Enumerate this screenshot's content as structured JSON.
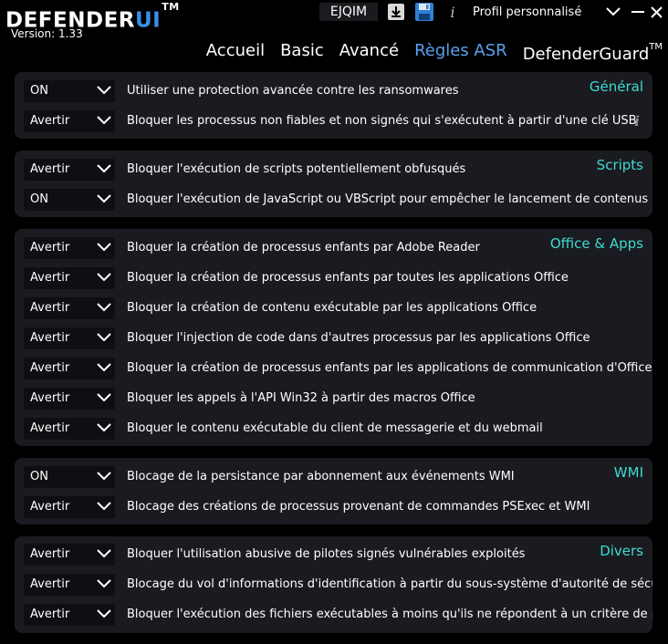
{
  "app": {
    "logo_main": "DEFENDER",
    "logo_accent": "UI",
    "logo_tm": "TM",
    "version": "Version: 1.33",
    "code": "EJQIM",
    "profile": "Profil personnalisé"
  },
  "nav": {
    "items": [
      {
        "label": "Accueil"
      },
      {
        "label": "Basic"
      },
      {
        "label": "Avancé"
      },
      {
        "label": "Règles ASR"
      },
      {
        "label": "DefenderGuard"
      }
    ],
    "guard_tm": "TM",
    "active_index": 3
  },
  "colors": {
    "accent_blue": "#3b8fe8",
    "section_title": "#3fd9d2",
    "panel_bg": "#1a1b20",
    "dropdown_bg": "#0e0f12"
  },
  "sections": [
    {
      "title": "Général",
      "rules": [
        {
          "value": "ON",
          "text": "Utiliser une protection avancée contre les ransomwares"
        },
        {
          "value": "Avertir",
          "text": "Bloquer les processus non fiables et non signés qui s'exécutent à partir d'une clé USB"
        }
      ]
    },
    {
      "title": "Scripts",
      "rules": [
        {
          "value": "Avertir",
          "text": "Bloquer l'exécution de scripts potentiellement obfusqués"
        },
        {
          "value": "ON",
          "text": "Bloquer l'exécution de JavaScript ou VBScript pour empêcher le lancement de contenus exécutables téléchargés"
        }
      ]
    },
    {
      "title": "Office & Apps",
      "rules": [
        {
          "value": "Avertir",
          "text": "Bloquer la création de processus enfants par Adobe Reader"
        },
        {
          "value": "Avertir",
          "text": "Bloquer la création de processus enfants par toutes les applications Office"
        },
        {
          "value": "Avertir",
          "text": "Bloquer la création de contenu exécutable par les applications Office"
        },
        {
          "value": "Avertir",
          "text": "Bloquer l'injection de code dans d'autres processus par les applications Office"
        },
        {
          "value": "Avertir",
          "text": "Bloquer la création de processus enfants par les applications de communication d'Office"
        },
        {
          "value": "Avertir",
          "text": "Bloquer les appels à l'API Win32 à partir des macros Office"
        },
        {
          "value": "Avertir",
          "text": "Bloquer le contenu exécutable du client de messagerie et du webmail"
        }
      ]
    },
    {
      "title": "WMI",
      "rules": [
        {
          "value": "ON",
          "text": "Blocage de la persistance par abonnement aux événements WMI"
        },
        {
          "value": "Avertir",
          "text": "Blocage des créations de processus provenant de commandes PSExec et WMI"
        }
      ]
    },
    {
      "title": "Divers",
      "rules": [
        {
          "value": "Avertir",
          "text": "Bloquer l'utilisation abusive de pilotes signés vulnérables exploités"
        },
        {
          "value": "Avertir",
          "text": "Blocage du vol d'informations d'identification à partir du sous-système d'autorité de sécurité locale (lsass.exe)"
        },
        {
          "value": "Avertir",
          "text": "Bloquer l'exécution des fichiers exécutables à moins qu'ils ne répondent à un critère de prévalence, d'âge ou de liste de confiance"
        }
      ]
    }
  ]
}
